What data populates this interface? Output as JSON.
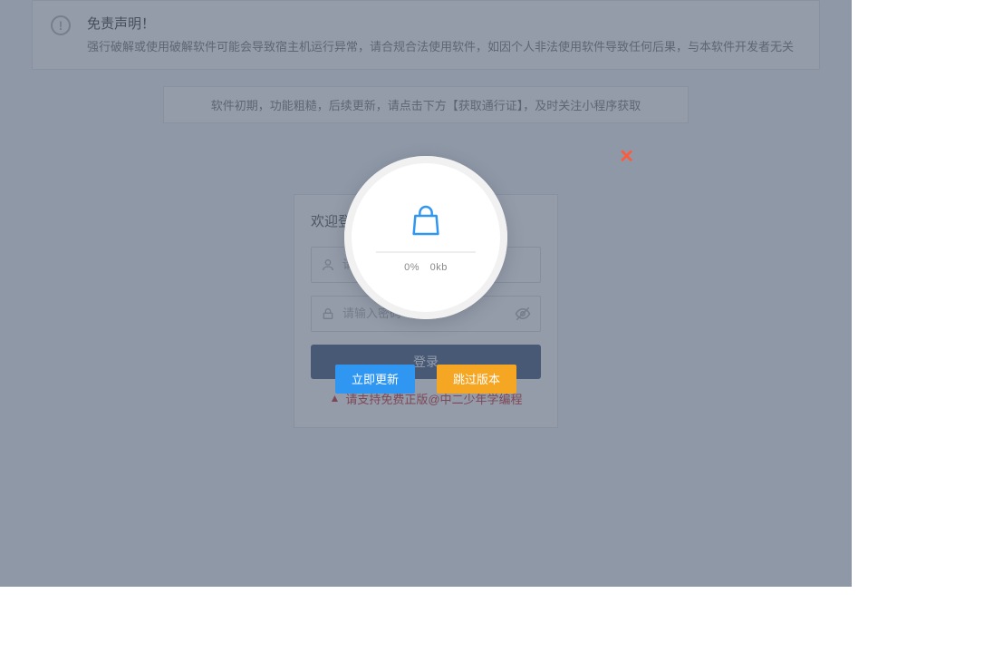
{
  "disclaimer": {
    "title": "免责声明！",
    "body": "强行破解或使用破解软件可能会导致宿主机运行异常，请合规合法使用软件，如因个人非法使用软件导致任何后果，与本软件开发者无关"
  },
  "notice": "软件初期，功能粗糙，后续更新，请点击下方【获取通行证】，及时关注小程序获取",
  "login": {
    "title": "欢迎登录",
    "username_placeholder": "请输入用户名",
    "password_placeholder": "请输入密码",
    "submit": "登录",
    "support": "请支持免费正版@中二少年学编程"
  },
  "modal": {
    "progress_percent": "0%",
    "progress_size": "0kb",
    "update_now": "立即更新",
    "skip_version": "跳过版本"
  }
}
